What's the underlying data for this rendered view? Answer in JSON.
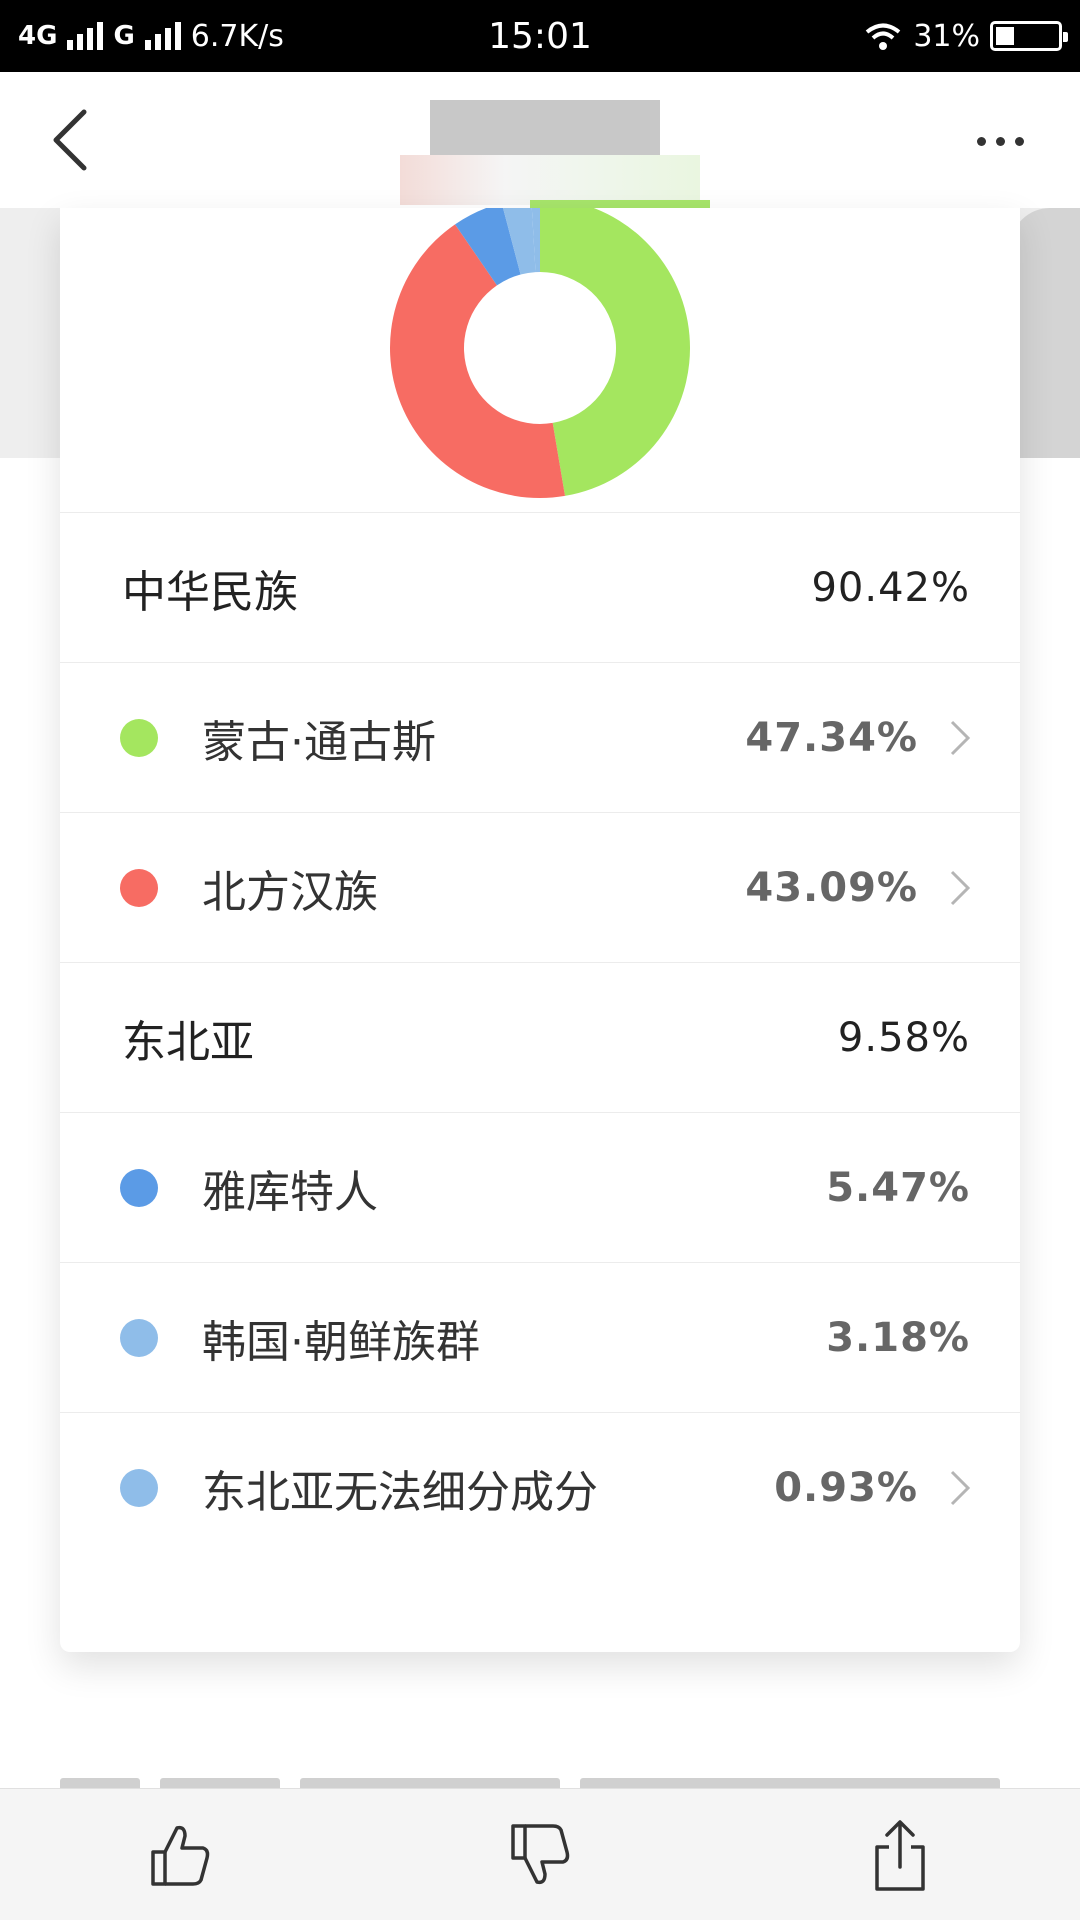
{
  "status_bar": {
    "network_1": "4G",
    "network_2": "G",
    "speed": "6.7K/s",
    "time": "15:01",
    "battery": "31%",
    "battery_level": 0.31
  },
  "nav": {
    "back_icon": "chevron-left-icon",
    "more_icon": "more-horizontal-icon"
  },
  "chart_data": {
    "type": "pie",
    "style": "donut",
    "labels": [
      "蒙古·通古斯",
      "北方汉族",
      "雅库特人",
      "韩国·朝鲜族群",
      "东北亚无法细分成分"
    ],
    "values": [
      47.34,
      43.09,
      5.47,
      3.18,
      0.93
    ],
    "colors": [
      "#a4e65f",
      "#f76c63",
      "#5b9be6",
      "#8fbde9",
      "#8fbde9"
    ]
  },
  "groups": [
    {
      "label": "中华民族",
      "value": "90.42%",
      "items": [
        {
          "label": "蒙古·通古斯",
          "value": "47.34%",
          "color": "#a4e65f",
          "chevron": true
        },
        {
          "label": "北方汉族",
          "value": "43.09%",
          "color": "#f76c63",
          "chevron": true
        }
      ]
    },
    {
      "label": "东北亚",
      "value": "9.58%",
      "items": [
        {
          "label": "雅库特人",
          "value": "5.47%",
          "color": "#5b9be6",
          "chevron": false
        },
        {
          "label": "韩国·朝鲜族群",
          "value": "3.18%",
          "color": "#8fbde9",
          "chevron": false
        },
        {
          "label": "东北亚无法细分成分",
          "value": "0.93%",
          "color": "#8fbde9",
          "chevron": true
        }
      ]
    }
  ],
  "toolbar": {
    "like_icon": "thumbs-up-icon",
    "dislike_icon": "thumbs-down-icon",
    "share_icon": "share-icon"
  }
}
